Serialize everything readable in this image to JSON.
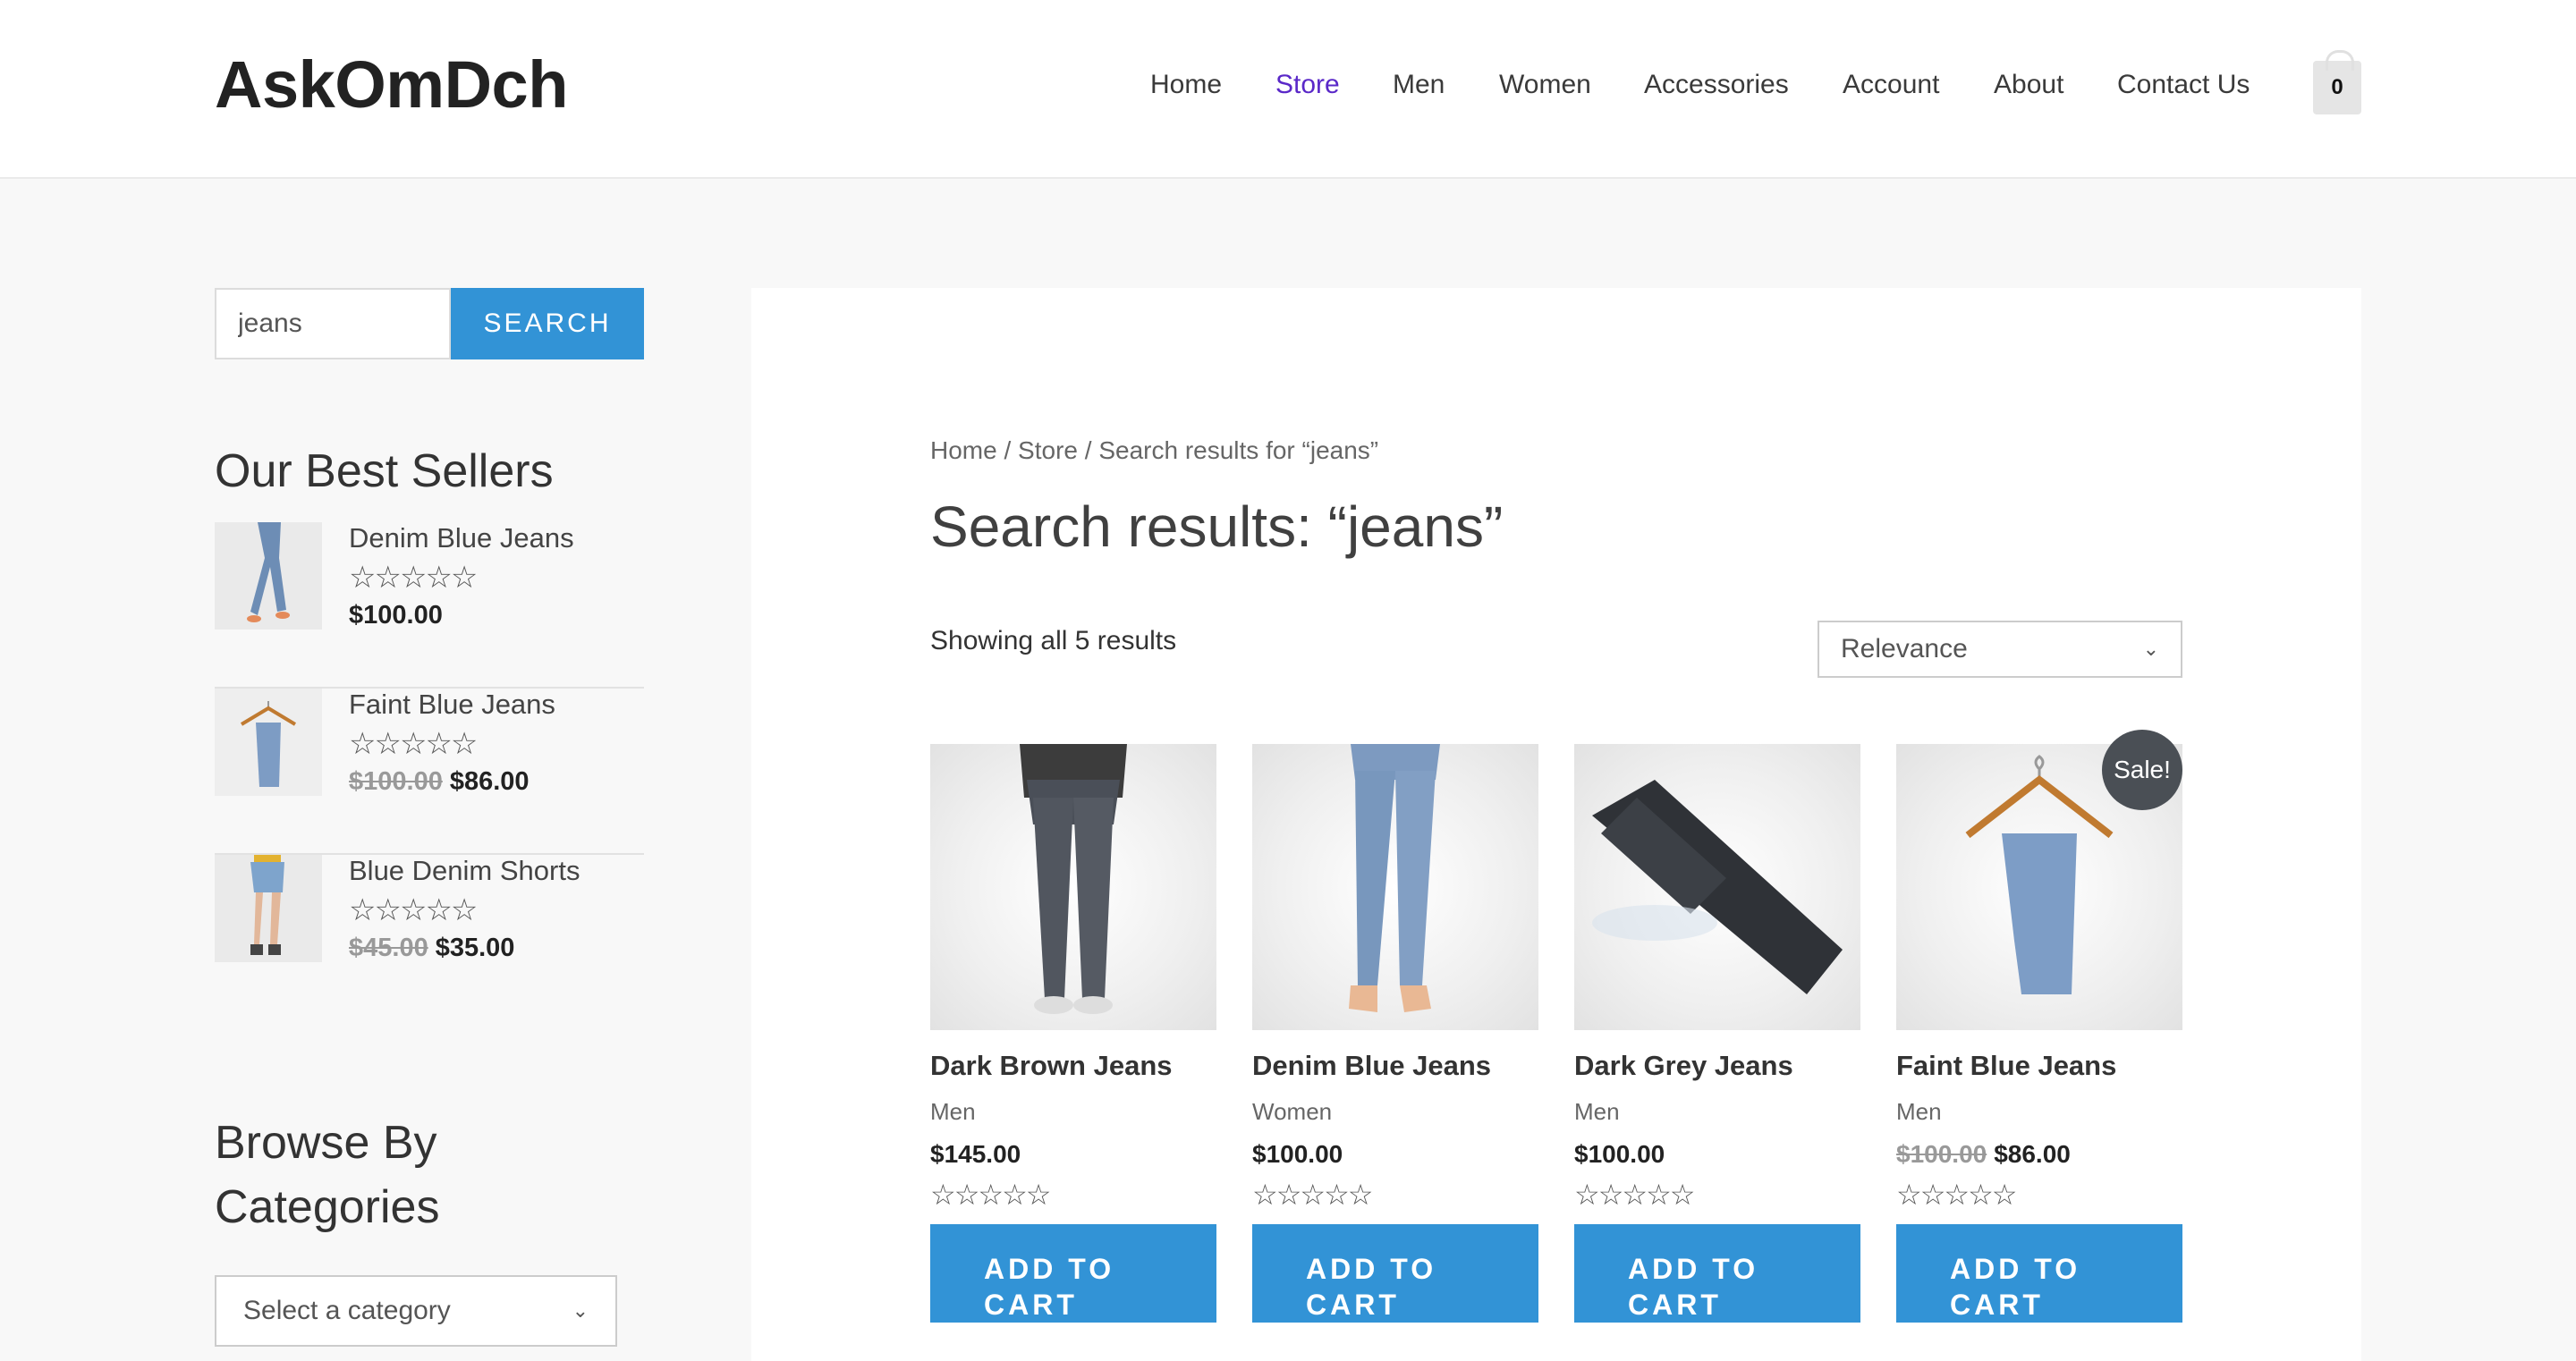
{
  "site": {
    "logo": "AskOmDch"
  },
  "nav": [
    {
      "label": "Home",
      "active": false
    },
    {
      "label": "Store",
      "active": true
    },
    {
      "label": "Men",
      "active": false
    },
    {
      "label": "Women",
      "active": false
    },
    {
      "label": "Accessories",
      "active": false
    },
    {
      "label": "Account",
      "active": false
    },
    {
      "label": "About",
      "active": false
    },
    {
      "label": "Contact Us",
      "active": false
    }
  ],
  "cart": {
    "count": "0",
    "icon": "shopping-bag-icon"
  },
  "sidebar": {
    "search": {
      "value": "jeans",
      "button_label": "SEARCH"
    },
    "best_sellers_title": "Our Best Sellers",
    "best_sellers": [
      {
        "name": "Denim Blue Jeans",
        "rating": "☆☆☆☆☆",
        "old_price": "",
        "price": "$100.00"
      },
      {
        "name": "Faint Blue Jeans",
        "rating": "☆☆☆☆☆",
        "old_price": "$100.00",
        "price": "$86.00"
      },
      {
        "name": "Blue Denim Shorts",
        "rating": "☆☆☆☆☆",
        "old_price": "$45.00",
        "price": "$35.00"
      }
    ],
    "categories_title": "Browse By Categories",
    "category_select": "Select a category"
  },
  "main": {
    "breadcrumb": {
      "home": "Home",
      "sep": " / ",
      "store": "Store",
      "current": "Search results for “jeans”"
    },
    "title": "Search results: “jeans”",
    "results_count": "Showing all 5 results",
    "sort": "Relevance",
    "products": [
      {
        "name": "Dark Brown Jeans",
        "category": "Men",
        "old_price": "",
        "price": "$145.00",
        "rating": "☆☆☆☆☆",
        "button": "ADD TO CART",
        "sale": ""
      },
      {
        "name": "Denim Blue Jeans",
        "category": "Women",
        "old_price": "",
        "price": "$100.00",
        "rating": "☆☆☆☆☆",
        "button": "ADD TO CART",
        "sale": ""
      },
      {
        "name": "Dark Grey Jeans",
        "category": "Men",
        "old_price": "",
        "price": "$100.00",
        "rating": "☆☆☆☆☆",
        "button": "ADD TO CART",
        "sale": ""
      },
      {
        "name": "Faint Blue Jeans",
        "category": "Men",
        "old_price": "$100.00",
        "price": "$86.00",
        "rating": "☆☆☆☆☆",
        "button": "ADD TO CART",
        "sale": "Sale!"
      }
    ]
  },
  "colors": {
    "accent": "#3293d6",
    "active_nav": "#5a28c8",
    "sale_badge": "#4a4f55"
  }
}
